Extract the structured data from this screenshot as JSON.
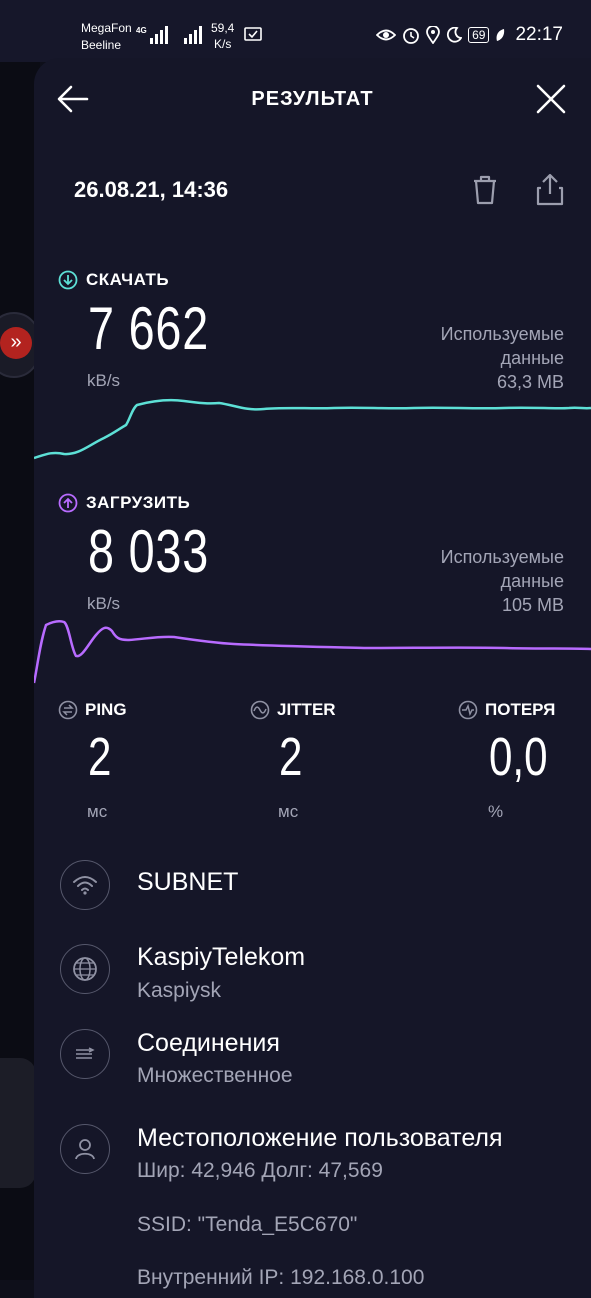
{
  "statusbar": {
    "carrier1": "MegaFon",
    "carrier2": "Beeline",
    "net_badge": "4G",
    "speed_value": "59,4",
    "speed_unit": "K/s",
    "battery": "69",
    "time": "22:17"
  },
  "header": {
    "title": "РЕЗУЛЬТАТ"
  },
  "date": "26.08.21, 14:36",
  "download": {
    "label": "СКАЧАТЬ",
    "value": "7 662",
    "unit": "kB/s",
    "used_line1": "Используемые",
    "used_line2": "данные",
    "used_amount": "63,3 MB",
    "color": "#5de0d6"
  },
  "upload": {
    "label": "ЗАГРУЗИТЬ",
    "value": "8 033",
    "unit": "kB/s",
    "used_line1": "Используемые",
    "used_line2": "данные",
    "used_amount": "105 MB",
    "color": "#b86bff"
  },
  "ping": {
    "label": "PING",
    "value": "2",
    "unit": "мс"
  },
  "jitter": {
    "label": "JITTER",
    "value": "2",
    "unit": "мс"
  },
  "loss": {
    "label": "ПОТЕРЯ",
    "value": "0,0",
    "unit": "%"
  },
  "info": {
    "network": {
      "title": "SUBNET",
      "icon": "wifi-icon"
    },
    "provider": {
      "title": "KaspiyTelekom",
      "subtitle": "Kaspiysk",
      "icon": "globe-icon"
    },
    "connections": {
      "title": "Соединения",
      "subtitle": "Множественное",
      "icon": "connections-icon"
    },
    "location": {
      "title": "Местоположение пользователя",
      "coords": "Шир: 42,946 Долг: 47,569",
      "ssid": "SSID: \"Tenda_E5C670\"",
      "internal_ip": "Внутренний IP: 192.168.0.100",
      "icon": "user-icon"
    }
  }
}
